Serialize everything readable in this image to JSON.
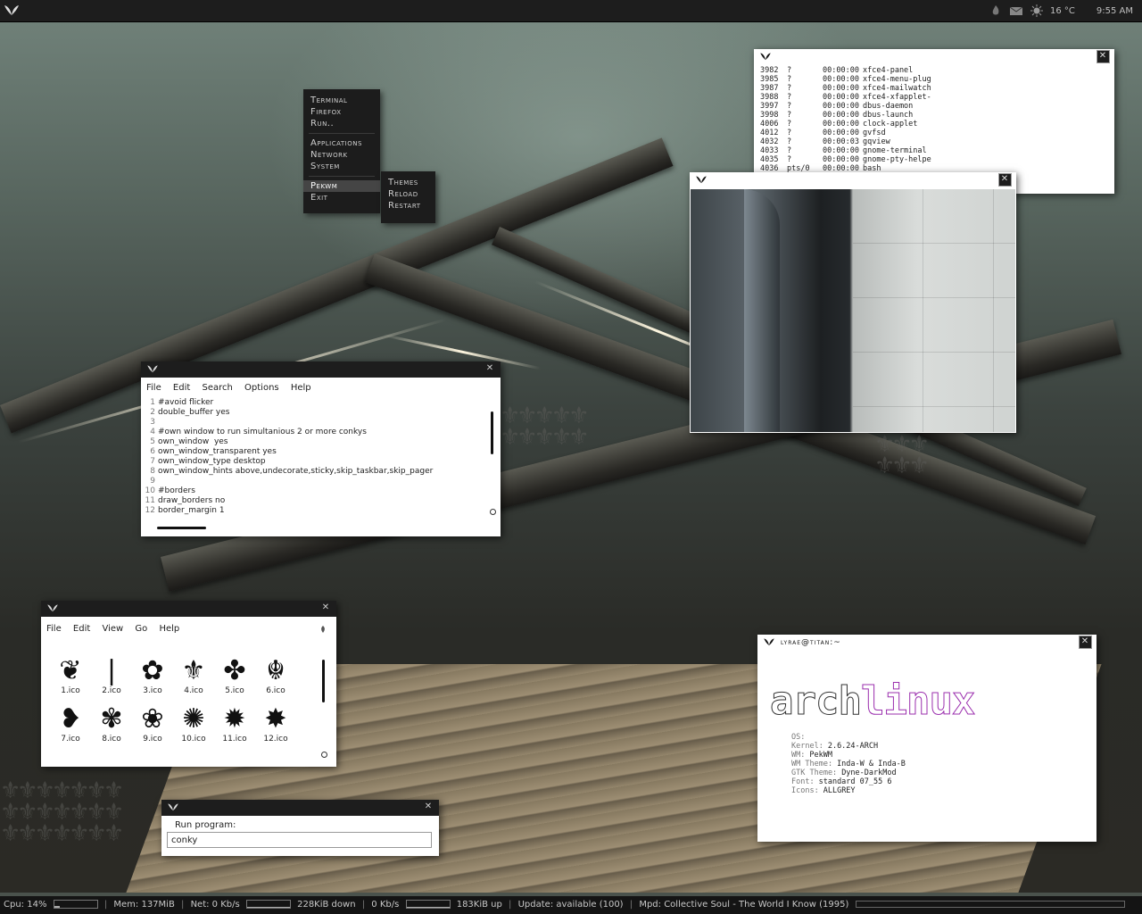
{
  "topbar": {
    "temperature": "16 °C",
    "clock": "9:55 AM",
    "icons": [
      "pekwm-logo-icon",
      "tray-flame-icon",
      "mail-icon",
      "weather-sun-icon"
    ]
  },
  "root_menu": {
    "items": [
      "Terminal",
      "Firefox",
      "Run..",
      "Applications",
      "Network",
      "System",
      "Pekwm",
      "Exit"
    ],
    "submenu": [
      "Themes",
      "Reload",
      "Restart"
    ]
  },
  "ps_window": {
    "rows": [
      {
        "pid": "3982",
        "tty": "?",
        "time": "00:00:00",
        "cmd": "xfce4-panel"
      },
      {
        "pid": "3985",
        "tty": "?",
        "time": "00:00:00",
        "cmd": "xfce4-menu-plug"
      },
      {
        "pid": "3987",
        "tty": "?",
        "time": "00:00:00",
        "cmd": "xfce4-mailwatch"
      },
      {
        "pid": "3988",
        "tty": "?",
        "time": "00:00:00",
        "cmd": "xfce4-xfapplet-"
      },
      {
        "pid": "3997",
        "tty": "?",
        "time": "00:00:00",
        "cmd": "dbus-daemon"
      },
      {
        "pid": "3998",
        "tty": "?",
        "time": "00:00:00",
        "cmd": "dbus-launch"
      },
      {
        "pid": "4006",
        "tty": "?",
        "time": "00:00:00",
        "cmd": "clock-applet"
      },
      {
        "pid": "4012",
        "tty": "?",
        "time": "00:00:00",
        "cmd": "gvfsd"
      },
      {
        "pid": "4032",
        "tty": "?",
        "time": "00:00:03",
        "cmd": "gqview"
      },
      {
        "pid": "4033",
        "tty": "?",
        "time": "00:00:00",
        "cmd": "gnome-terminal"
      },
      {
        "pid": "4035",
        "tty": "?",
        "time": "00:00:00",
        "cmd": "gnome-pty-helpe"
      },
      {
        "pid": "4036",
        "tty": "pts/0",
        "time": "00:00:00",
        "cmd": "bash"
      }
    ]
  },
  "editor": {
    "menu": [
      "File",
      "Edit",
      "Search",
      "Options",
      "Help"
    ],
    "lines": [
      {
        "n": "1",
        "t": "#avoid flicker"
      },
      {
        "n": "2",
        "t": "double_buffer yes"
      },
      {
        "n": "3",
        "t": ""
      },
      {
        "n": "4",
        "t": "#own window to run simultanious 2 or more conkys"
      },
      {
        "n": "5",
        "t": "own_window  yes"
      },
      {
        "n": "6",
        "t": "own_window_transparent yes"
      },
      {
        "n": "7",
        "t": "own_window_type desktop"
      },
      {
        "n": "8",
        "t": "own_window_hints above,undecorate,sticky,skip_taskbar,skip_pager"
      },
      {
        "n": "9",
        "t": ""
      },
      {
        "n": "10",
        "t": "#borders"
      },
      {
        "n": "11",
        "t": "draw_borders no"
      },
      {
        "n": "12",
        "t": "border_margin 1"
      }
    ]
  },
  "filemanager": {
    "menu": [
      "File",
      "Edit",
      "View",
      "Go",
      "Help"
    ],
    "files": [
      {
        "name": "1.ico",
        "glyph": "❦"
      },
      {
        "name": "2.ico",
        "glyph": "❘"
      },
      {
        "name": "3.ico",
        "glyph": "✿"
      },
      {
        "name": "4.ico",
        "glyph": "⚜"
      },
      {
        "name": "5.ico",
        "glyph": "✤"
      },
      {
        "name": "6.ico",
        "glyph": "☬"
      },
      {
        "name": "7.ico",
        "glyph": "❥"
      },
      {
        "name": "8.ico",
        "glyph": "✾"
      },
      {
        "name": "9.ico",
        "glyph": "❀"
      },
      {
        "name": "10.ico",
        "glyph": "✺"
      },
      {
        "name": "11.ico",
        "glyph": "✹"
      },
      {
        "name": "12.ico",
        "glyph": "✸"
      }
    ]
  },
  "run_dialog": {
    "label": "Run program:",
    "value": "conky"
  },
  "terminal": {
    "title": "lyrae@titan:~",
    "logo_left": "arch",
    "logo_right": "linux",
    "logo_left_color": "#333333",
    "logo_right_color": "#9b2fae",
    "info": [
      {
        "k": "OS:",
        "v": ""
      },
      {
        "k": "Kernel:",
        "v": "2.6.24-ARCH"
      },
      {
        "k": "WM:",
        "v": "PekWM"
      },
      {
        "k": "WM Theme:",
        "v": "Inda-W & Inda-B"
      },
      {
        "k": "GTK Theme:",
        "v": "Dyne-DarkMod"
      },
      {
        "k": "Font:",
        "v": "standard 07_55 6"
      },
      {
        "k": "Icons:",
        "v": "ALLGREY"
      }
    ]
  },
  "statusbar": {
    "cpu": "Cpu: 14%",
    "cpu_fraction": 0.14,
    "mem": "Mem: 137MiB",
    "net_down_label": "Net: 0 Kb/s",
    "net_down_total": "228KiB down",
    "net_up_label": "0 Kb/s",
    "net_up_total": "183KiB up",
    "update": "Update: available (100)",
    "mpd": "Mpd: Collective Soul - The World I Know (1995)",
    "mpd_progress": 0.0
  }
}
